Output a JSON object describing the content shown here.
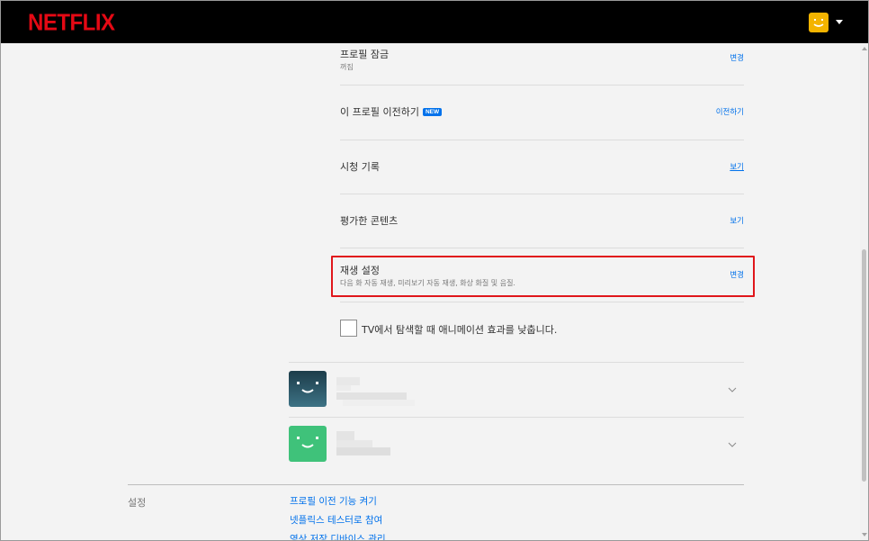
{
  "header": {
    "logo": "NETFLIX"
  },
  "rows": [
    {
      "title": "프로필 잠금",
      "subtitle": "꺼짐",
      "link": "변경"
    },
    {
      "title": "이 프로필 이전하기",
      "badge": "NEW",
      "link": "이전하기"
    },
    {
      "title": "시청 기록",
      "link": "보기"
    },
    {
      "title": "평가한 콘텐츠",
      "link": "보기"
    },
    {
      "title": "재생 설정",
      "subtitle": "다음 화 자동 재생, 미리보기 자동 재생, 화상 화질 및 음질.",
      "link": "변경"
    }
  ],
  "checkbox": {
    "label": "TV에서 탐색할 때 애니메이션 효과를 낮춥니다.",
    "checked": false
  },
  "profiles": [
    {
      "avatar_color": "#2d5a6b",
      "icon": "smiley-avatar-icon"
    },
    {
      "avatar_color": "#3fc27a",
      "icon": "smiley-avatar-icon"
    }
  ],
  "settings": {
    "label": "설정",
    "links": [
      "프로필 이전 기능 켜기",
      "넷플릭스 테스터로 참여",
      "영상 저장 디바이스 관리"
    ]
  },
  "colors": {
    "brand": "#e50914",
    "link": "#0071eb",
    "highlight": "#e0161b"
  }
}
